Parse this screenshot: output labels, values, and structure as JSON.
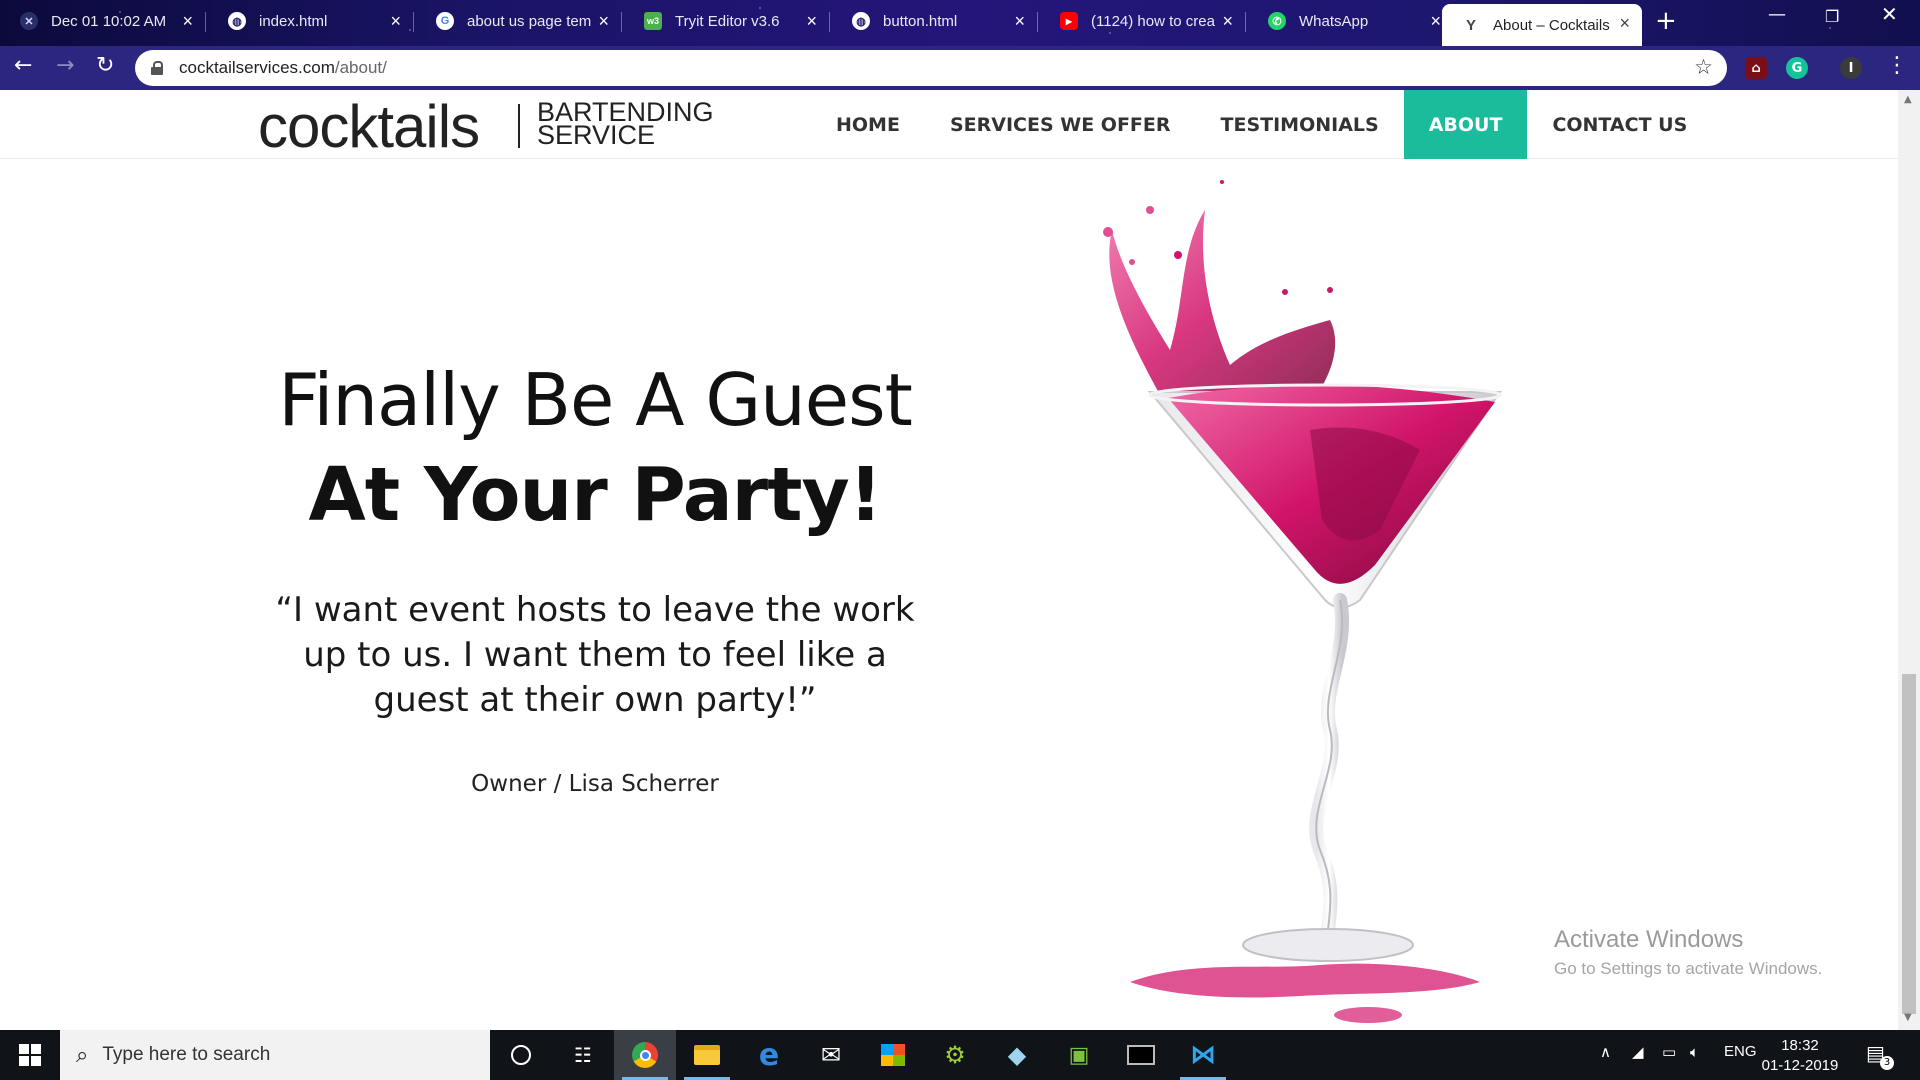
{
  "browser": {
    "tabs": [
      {
        "title": "Dec 01 10:02 AM",
        "favicon": "space-icon"
      },
      {
        "title": "index.html",
        "favicon": "globe-icon"
      },
      {
        "title": "about us page tem",
        "favicon": "google-icon"
      },
      {
        "title": "Tryit Editor v3.6",
        "favicon": "w3schools-icon"
      },
      {
        "title": "button.html",
        "favicon": "globe-icon"
      },
      {
        "title": "(1124) how to crea",
        "favicon": "youtube-icon"
      },
      {
        "title": "WhatsApp",
        "favicon": "whatsapp-icon"
      },
      {
        "title": "About – Cocktails",
        "favicon": "cocktail-icon",
        "active": true
      }
    ],
    "url_host": "cocktailservices.com",
    "url_path": "/about/"
  },
  "site": {
    "logo": {
      "word": "cocktails",
      "sub_line1": "BARTENDING",
      "sub_line2": "SERVICE"
    },
    "nav": [
      {
        "label": "HOME"
      },
      {
        "label": "SERVICES WE OFFER"
      },
      {
        "label": "TESTIMONIALS"
      },
      {
        "label": "ABOUT",
        "active": true
      },
      {
        "label": "CONTACT US"
      }
    ],
    "accent_color": "#1abc9c"
  },
  "hero": {
    "line1": "Finally Be A Guest",
    "line2": "At Your Party!",
    "quote": "“I want event hosts to leave the work up to us. I want them to feel like a guest at their own party!”",
    "attribution": "Owner / Lisa Scherrer"
  },
  "watermark": {
    "title": "Activate Windows",
    "subtitle": "Go to Settings to activate Windows."
  },
  "taskbar": {
    "search_placeholder": "Type here to search",
    "language": "ENG",
    "time": "18:32",
    "date": "01-12-2019",
    "notification_count": "3"
  }
}
